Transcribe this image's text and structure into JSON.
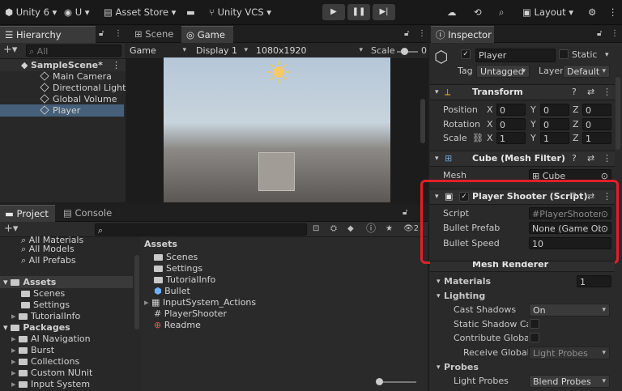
{
  "toolbar": {
    "app": "Unity 6",
    "account": "U",
    "asset_store": "Asset Store",
    "vcs": "Unity VCS",
    "layout": "Layout"
  },
  "hierarchy": {
    "tab": "Hierarchy",
    "search_placeholder": "All",
    "scene": "SampleScene*",
    "items": [
      "Main Camera",
      "Directional Light",
      "Global Volume",
      "Player"
    ]
  },
  "view": {
    "scene_tab": "Scene",
    "game_tab": "Game",
    "mode": "Game",
    "display": "Display 1",
    "resolution": "1080x1920",
    "scale_label": "Scale",
    "scale_value": "0"
  },
  "project": {
    "project_tab": "Project",
    "console_tab": "Console",
    "favorites": [
      "All Materials",
      "All Models",
      "All Prefabs"
    ],
    "assets_label": "Assets",
    "assets_children": [
      "Scenes",
      "Settings",
      "TutorialInfo"
    ],
    "packages_label": "Packages",
    "packages_children": [
      "AI Navigation",
      "Burst",
      "Collections",
      "Custom NUnit",
      "Input System"
    ],
    "breadcrumb": "Assets",
    "files": [
      "Scenes",
      "Settings",
      "TutorialInfo",
      "Bullet",
      "InputSystem_Actions",
      "PlayerShooter",
      "Readme"
    ],
    "count": "2"
  },
  "inspector": {
    "tab": "Inspector",
    "name": "Player",
    "static_label": "Static",
    "tag_label": "Tag",
    "tag_value": "Untagged",
    "layer_label": "Layer",
    "layer_value": "Default",
    "transform": {
      "title": "Transform",
      "position_label": "Position",
      "rotation_label": "Rotation",
      "scale_label": "Scale",
      "position": [
        "0",
        "0",
        "0"
      ],
      "rotation": [
        "0",
        "0",
        "0"
      ],
      "scale": [
        "1",
        "1",
        "1"
      ],
      "axes": [
        "X",
        "Y",
        "Z"
      ]
    },
    "mesh_filter": {
      "title": "Cube (Mesh Filter)",
      "mesh_label": "Mesh",
      "mesh_value": "Cube"
    },
    "shooter": {
      "title": "Player Shooter (Script)",
      "script_label": "Script",
      "script_value": "PlayerShooter",
      "prefab_label": "Bullet Prefab",
      "prefab_value": "None (Game Ob",
      "speed_label": "Bullet Speed",
      "speed_value": "10"
    },
    "mesh_renderer": {
      "title": "Mesh Renderer"
    },
    "materials": {
      "label": "Materials",
      "value": "1"
    },
    "lighting": {
      "label": "Lighting",
      "cast_shadows_label": "Cast Shadows",
      "cast_shadows_value": "On",
      "static_shadow_label": "Static Shadow Cas",
      "contrib_gi_label": "Contribute Global I",
      "receive_gi_label": "Receive Global I",
      "receive_gi_value": "Light Probes"
    },
    "probes": {
      "label": "Probes",
      "light_probes_label": "Light Probes",
      "light_probes_value": "Blend Probes"
    }
  },
  "colors": {
    "highlight": "#e0202a",
    "selection": "#2c5d87",
    "accent_transform": "#f0b429"
  }
}
